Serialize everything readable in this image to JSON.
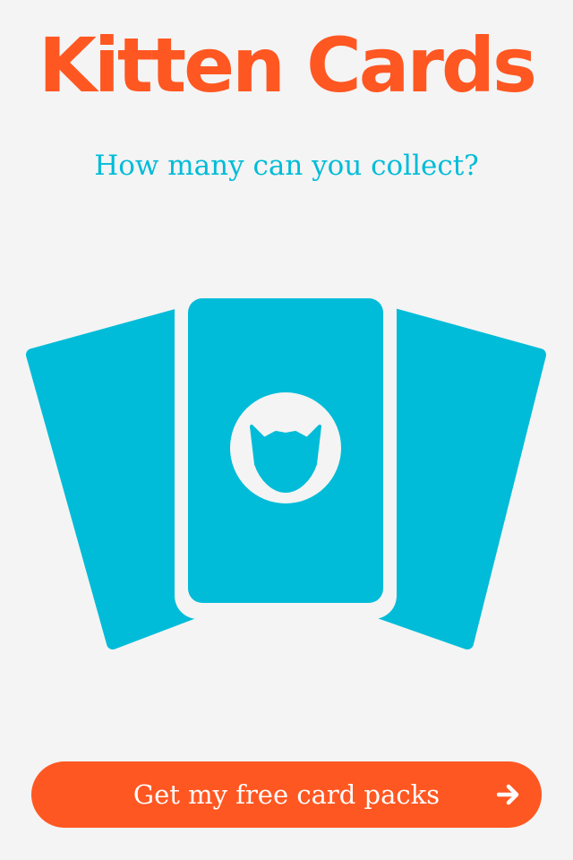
{
  "app": {
    "title": "Kitten Cards",
    "subtitle": "How many can you collect?"
  },
  "illustration": {
    "card_icons": [
      "card-back-icon",
      "card-back-icon",
      "card-front-icon"
    ],
    "emblem_icon": "cat-head-icon"
  },
  "cta": {
    "label": "Get my free card packs",
    "icon": "arrow-right-icon"
  },
  "colors": {
    "background": "#f4f4f4",
    "brand_orange": "#ff5722",
    "accent_cyan": "#00bcd8",
    "white": "#ffffff"
  }
}
